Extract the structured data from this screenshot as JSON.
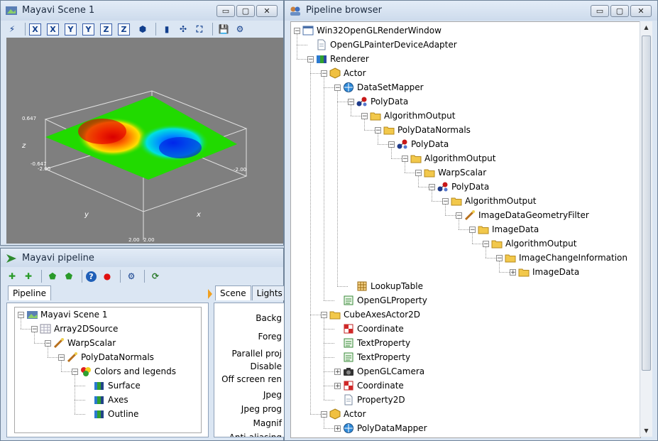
{
  "scene_window": {
    "title": "Mayavi Scene 1",
    "controls": {
      "minimize": "▭",
      "maximize": "▢",
      "close": "✕"
    },
    "toolbar": [
      {
        "name": "mayavi-logo-icon",
        "glyph": "⚡"
      },
      {
        "name": "view-x-icon",
        "glyph": "X"
      },
      {
        "name": "view-x-neg-icon",
        "glyph": "X"
      },
      {
        "name": "view-y-icon",
        "glyph": "Y"
      },
      {
        "name": "view-y-neg-icon",
        "glyph": "Y"
      },
      {
        "name": "view-z-icon",
        "glyph": "Z"
      },
      {
        "name": "view-z-neg-icon",
        "glyph": "Z"
      },
      {
        "name": "isometric-view-icon",
        "glyph": "⬢"
      },
      {
        "name": "parallel-projection-icon",
        "glyph": "▮"
      },
      {
        "name": "axes-indicator-icon",
        "glyph": "✣"
      },
      {
        "name": "fullscreen-icon",
        "glyph": "⛶"
      },
      {
        "name": "save-icon",
        "glyph": "💾"
      },
      {
        "name": "settings-icon",
        "glyph": "⚙"
      }
    ],
    "plot": {
      "z_max_label": "0.647",
      "z_min_label": "-0.647",
      "x_min_left": "-2.00",
      "z_axis": "z",
      "y_axis": "y",
      "x_axis": "x",
      "x_min_right": "-2.00",
      "bottom_left": "2.00",
      "bottom_right": "2.00"
    }
  },
  "pipeline_window": {
    "title": "Mayavi pipeline",
    "toolbar": [
      {
        "name": "add-scene-icon",
        "glyph": "✚"
      },
      {
        "name": "add-source-icon",
        "glyph": "✚"
      },
      {
        "name": "add-filter-icon",
        "glyph": "⬟"
      },
      {
        "name": "add-module-icon",
        "glyph": "⬟"
      },
      {
        "name": "help-icon",
        "glyph": "?"
      },
      {
        "name": "record-icon",
        "glyph": "●"
      },
      {
        "name": "preferences-icon",
        "glyph": "⚙"
      },
      {
        "name": "refresh-icon",
        "glyph": "⟳"
      }
    ],
    "tab_label": "Pipeline",
    "tree": [
      {
        "label": "Mayavi Scene 1",
        "level": 0,
        "icon": "scene-icon",
        "expanded": true
      },
      {
        "label": "Array2DSource",
        "level": 1,
        "icon": "array-source-icon",
        "expanded": true
      },
      {
        "label": "WarpScalar",
        "level": 2,
        "icon": "filter-wand-icon",
        "expanded": true
      },
      {
        "label": "PolyDataNormals",
        "level": 3,
        "icon": "filter-wand-icon",
        "expanded": true
      },
      {
        "label": "Colors and legends",
        "level": 4,
        "icon": "colors-legends-icon",
        "expanded": true
      },
      {
        "label": "Surface",
        "level": 5,
        "icon": "module-icon"
      },
      {
        "label": "Axes",
        "level": 5,
        "icon": "module-icon"
      },
      {
        "label": "Outline",
        "level": 5,
        "icon": "module-icon"
      }
    ],
    "scene_tabs": [
      "Scene",
      "Lights"
    ],
    "scene_props": [
      "Backg",
      "Foreg",
      "Parallel proj",
      "Disable",
      "Off screen ren",
      "Jpeg",
      "Jpeg prog",
      "Magnif",
      "Anti-aliasing"
    ]
  },
  "browser_window": {
    "title": "Pipeline browser",
    "tree": [
      {
        "label": "Win32OpenGLRenderWindow",
        "level": 0,
        "icon": "window-icon",
        "expander": "minus"
      },
      {
        "label": "OpenGLPainterDeviceAdapter",
        "level": 1,
        "icon": "document-icon"
      },
      {
        "label": "Renderer",
        "level": 1,
        "icon": "renderer-icon",
        "expander": "minus"
      },
      {
        "label": "Actor",
        "level": 2,
        "icon": "actor-icon",
        "expander": "minus"
      },
      {
        "label": "DataSetMapper",
        "level": 3,
        "icon": "mapper-icon",
        "expander": "minus"
      },
      {
        "label": "PolyData",
        "level": 4,
        "icon": "polydata-icon",
        "expander": "minus"
      },
      {
        "label": "AlgorithmOutput",
        "level": 5,
        "icon": "folder-icon",
        "expander": "minus"
      },
      {
        "label": "PolyDataNormals",
        "level": 6,
        "icon": "folder-icon",
        "expander": "minus"
      },
      {
        "label": "PolyData",
        "level": 7,
        "icon": "polydata-icon",
        "expander": "minus"
      },
      {
        "label": "AlgorithmOutput",
        "level": 8,
        "icon": "folder-icon",
        "expander": "minus"
      },
      {
        "label": "WarpScalar",
        "level": 9,
        "icon": "folder-icon",
        "expander": "minus"
      },
      {
        "label": "PolyData",
        "level": 10,
        "icon": "polydata-icon",
        "expander": "minus"
      },
      {
        "label": "AlgorithmOutput",
        "level": 11,
        "icon": "folder-icon",
        "expander": "minus"
      },
      {
        "label": "ImageDataGeometryFilter",
        "level": 12,
        "icon": "filter-wand-icon",
        "expander": "minus"
      },
      {
        "label": "ImageData",
        "level": 13,
        "icon": "folder-icon",
        "expander": "minus"
      },
      {
        "label": "AlgorithmOutput",
        "level": 14,
        "icon": "folder-icon",
        "expander": "minus"
      },
      {
        "label": "ImageChangeInformation",
        "level": 15,
        "icon": "folder-icon",
        "expander": "minus"
      },
      {
        "label": "ImageData",
        "level": 16,
        "icon": "folder-icon",
        "expander": "plus"
      },
      {
        "label": "LookupTable",
        "level": 4,
        "icon": "lookup-table-icon"
      },
      {
        "label": "OpenGLProperty",
        "level": 3,
        "icon": "property-icon"
      },
      {
        "label": "CubeAxesActor2D",
        "level": 2,
        "icon": "folder-icon",
        "expander": "minus"
      },
      {
        "label": "Coordinate",
        "level": 3,
        "icon": "coordinate-icon"
      },
      {
        "label": "TextProperty",
        "level": 3,
        "icon": "property-icon"
      },
      {
        "label": "TextProperty",
        "level": 3,
        "icon": "property-icon"
      },
      {
        "label": "OpenGLCamera",
        "level": 3,
        "icon": "camera-icon",
        "expander": "plus"
      },
      {
        "label": "Coordinate",
        "level": 3,
        "icon": "coordinate-icon",
        "expander": "plus"
      },
      {
        "label": "Property2D",
        "level": 3,
        "icon": "document-icon"
      },
      {
        "label": "Actor",
        "level": 2,
        "icon": "actor-icon",
        "expander": "minus"
      },
      {
        "label": "PolyDataMapper",
        "level": 3,
        "icon": "mapper-icon",
        "expander": "plus"
      }
    ]
  },
  "colors": {
    "surface_high": "#d40000",
    "surface_mid": "#22e000",
    "surface_low": "#0044ff",
    "selection_bg": "#3399ff"
  }
}
